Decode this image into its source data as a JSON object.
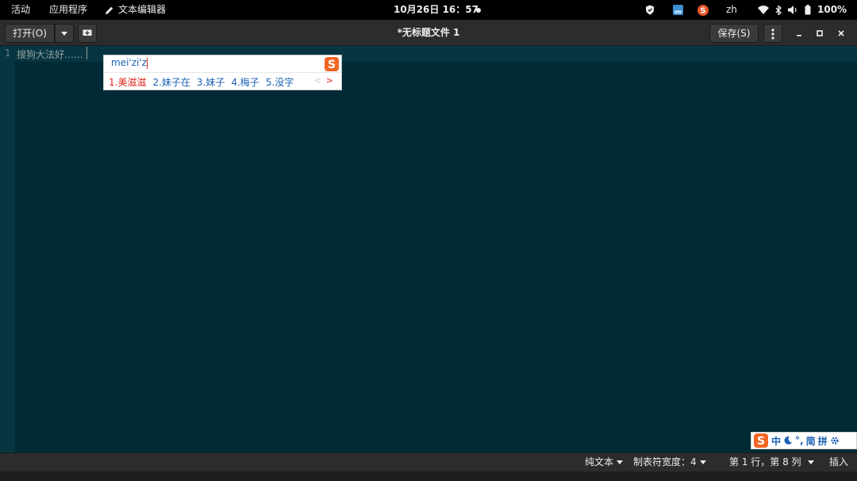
{
  "topbar": {
    "activities": "活动",
    "applications": "应用程序",
    "app_name": "文本编辑器",
    "clock": "10月26日  16：57",
    "input_method": "zh",
    "battery": "100%"
  },
  "headerbar": {
    "open_label": "打开(O)",
    "title": "*无标题文件 1",
    "save_label": "保存(S)"
  },
  "editor": {
    "line_number": "1",
    "line_text": "搜狗大法好……"
  },
  "ime": {
    "composition": "mei'zi'z",
    "candidates": [
      "1.美滋滋",
      "2.妹子在",
      "3.妹子",
      "4.梅子",
      "5.没字"
    ]
  },
  "sogou_bar": {
    "mode": "中",
    "punct": "°,",
    "simplified": "简",
    "pinyin": "拼"
  },
  "statusbar": {
    "language": "纯文本",
    "tab_width": "制表符宽度：4",
    "position": "第 1 行，第 8 列",
    "insert_mode": "插入"
  },
  "colors": {
    "editor_bg": "#002b36",
    "current_line": "#073642",
    "ime_selected": "#e0231a",
    "ime_candidate": "#1a5fb4",
    "sogou_orange": "#f26522"
  }
}
